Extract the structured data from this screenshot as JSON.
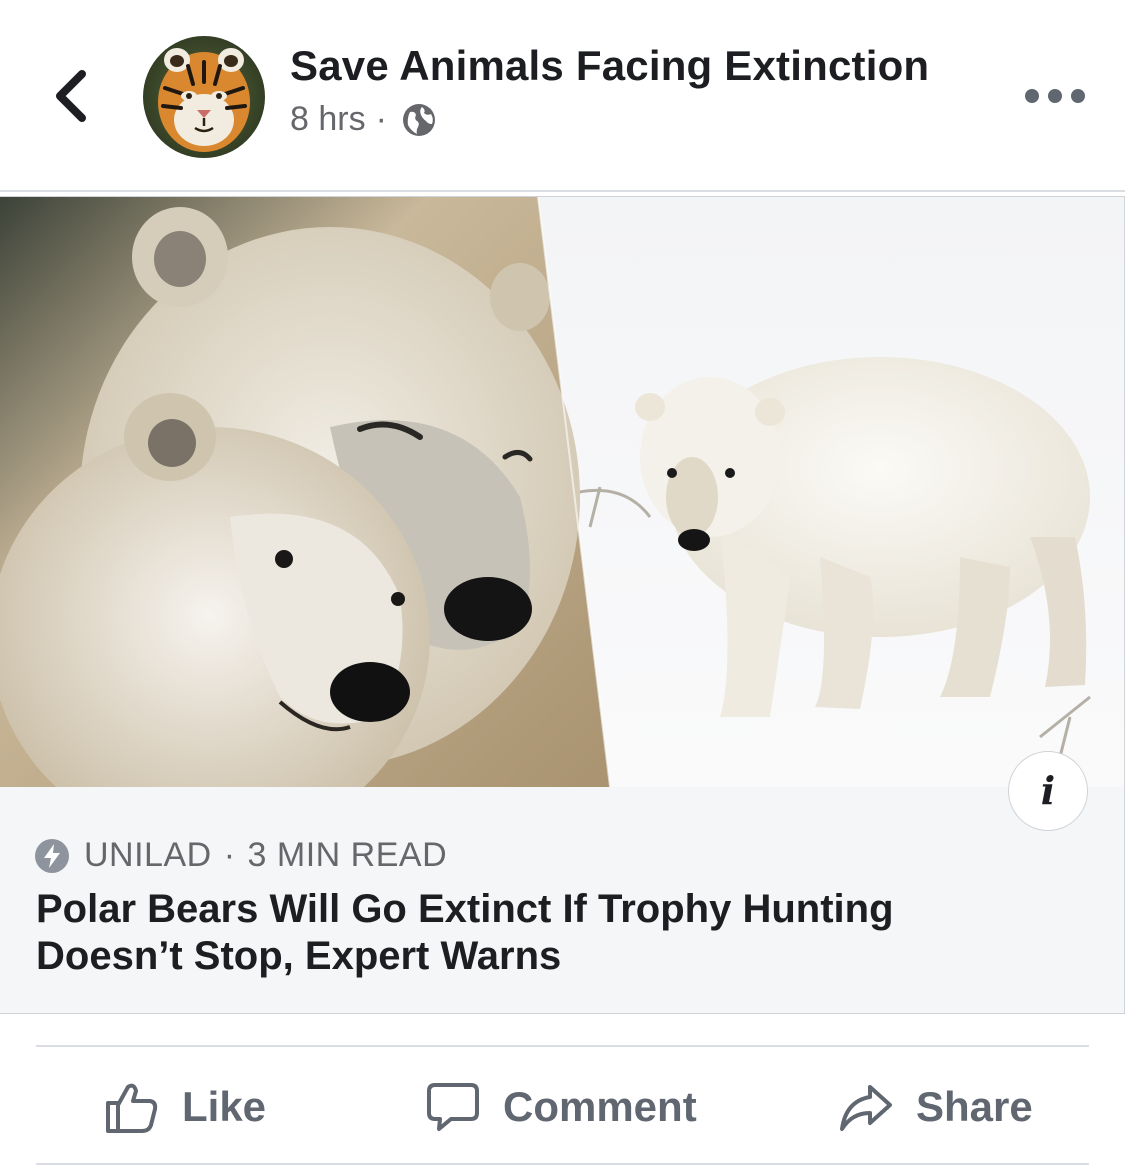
{
  "post": {
    "page_name": "Save Animals Facing Extinction",
    "time": "8 hrs",
    "separator": "·",
    "privacy_icon": "globe-icon"
  },
  "link_card": {
    "source": "UNILAD",
    "separator": "·",
    "read_time": "3 MIN READ",
    "headline": "Polar Bears Will Go Extinct If Trophy Hunting Doesn’t Stop, Expert Warns",
    "info_label": "i"
  },
  "actions": {
    "like": "Like",
    "comment": "Comment",
    "share": "Share"
  },
  "colors": {
    "text_primary": "#1c1e21",
    "text_secondary": "#65676b",
    "divider": "#dadde1",
    "card_background": "#f5f6f7"
  }
}
